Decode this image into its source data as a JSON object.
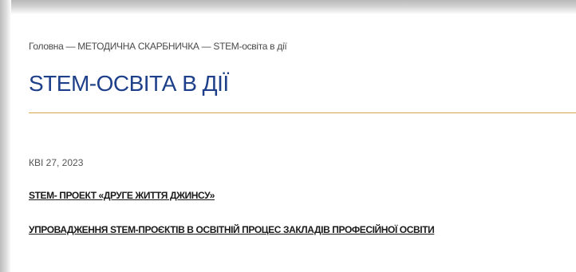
{
  "breadcrumb": {
    "home": "Головна",
    "separator": "—",
    "section": "МЕТОДИЧНА СКАРБНИЧКА",
    "current": "STEM-освіта в дії"
  },
  "page": {
    "title": "STEM-ОСВІТА В ДІЇ"
  },
  "post": {
    "date": "КВІ 27, 2023",
    "links": [
      {
        "label": "STEM- ПРОЕКТ «ДРУГЕ ЖИТТЯ ДЖИНСУ»"
      },
      {
        "label": "УПРОВАДЖЕННЯ STEM-ПРОЄКТІВ В ОСВІТНІЙ ПРОЦЕС ЗАКЛАДІВ ПРОФЕСІЙНОЇ ОСВІТИ"
      }
    ]
  },
  "colors": {
    "title": "#1e3f8a",
    "divider": "#d9a94a",
    "text": "#4a4a4a"
  }
}
